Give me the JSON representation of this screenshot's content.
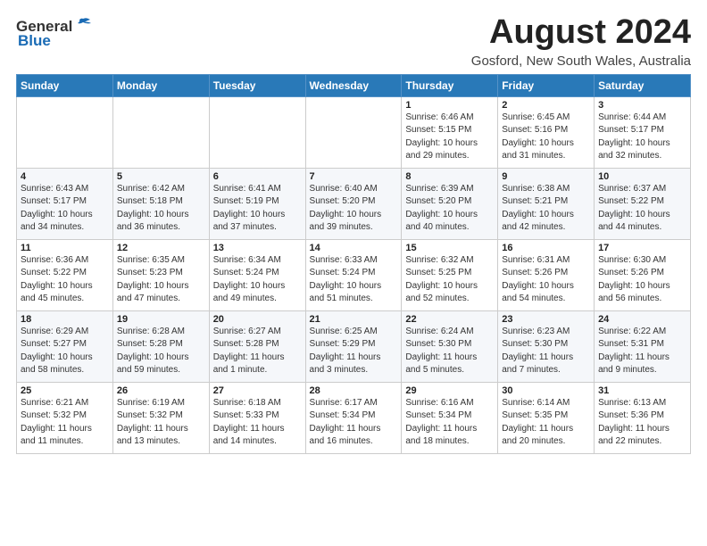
{
  "header": {
    "logo_general": "General",
    "logo_blue": "Blue",
    "month_year": "August 2024",
    "location": "Gosford, New South Wales, Australia"
  },
  "calendar": {
    "days_of_week": [
      "Sunday",
      "Monday",
      "Tuesday",
      "Wednesday",
      "Thursday",
      "Friday",
      "Saturday"
    ],
    "weeks": [
      [
        {
          "day": "",
          "sunrise": "",
          "sunset": "",
          "daylight": ""
        },
        {
          "day": "",
          "sunrise": "",
          "sunset": "",
          "daylight": ""
        },
        {
          "day": "",
          "sunrise": "",
          "sunset": "",
          "daylight": ""
        },
        {
          "day": "",
          "sunrise": "",
          "sunset": "",
          "daylight": ""
        },
        {
          "day": "1",
          "sunrise": "Sunrise: 6:46 AM",
          "sunset": "Sunset: 5:15 PM",
          "daylight": "Daylight: 10 hours and 29 minutes."
        },
        {
          "day": "2",
          "sunrise": "Sunrise: 6:45 AM",
          "sunset": "Sunset: 5:16 PM",
          "daylight": "Daylight: 10 hours and 31 minutes."
        },
        {
          "day": "3",
          "sunrise": "Sunrise: 6:44 AM",
          "sunset": "Sunset: 5:17 PM",
          "daylight": "Daylight: 10 hours and 32 minutes."
        }
      ],
      [
        {
          "day": "4",
          "sunrise": "Sunrise: 6:43 AM",
          "sunset": "Sunset: 5:17 PM",
          "daylight": "Daylight: 10 hours and 34 minutes."
        },
        {
          "day": "5",
          "sunrise": "Sunrise: 6:42 AM",
          "sunset": "Sunset: 5:18 PM",
          "daylight": "Daylight: 10 hours and 36 minutes."
        },
        {
          "day": "6",
          "sunrise": "Sunrise: 6:41 AM",
          "sunset": "Sunset: 5:19 PM",
          "daylight": "Daylight: 10 hours and 37 minutes."
        },
        {
          "day": "7",
          "sunrise": "Sunrise: 6:40 AM",
          "sunset": "Sunset: 5:20 PM",
          "daylight": "Daylight: 10 hours and 39 minutes."
        },
        {
          "day": "8",
          "sunrise": "Sunrise: 6:39 AM",
          "sunset": "Sunset: 5:20 PM",
          "daylight": "Daylight: 10 hours and 40 minutes."
        },
        {
          "day": "9",
          "sunrise": "Sunrise: 6:38 AM",
          "sunset": "Sunset: 5:21 PM",
          "daylight": "Daylight: 10 hours and 42 minutes."
        },
        {
          "day": "10",
          "sunrise": "Sunrise: 6:37 AM",
          "sunset": "Sunset: 5:22 PM",
          "daylight": "Daylight: 10 hours and 44 minutes."
        }
      ],
      [
        {
          "day": "11",
          "sunrise": "Sunrise: 6:36 AM",
          "sunset": "Sunset: 5:22 PM",
          "daylight": "Daylight: 10 hours and 45 minutes."
        },
        {
          "day": "12",
          "sunrise": "Sunrise: 6:35 AM",
          "sunset": "Sunset: 5:23 PM",
          "daylight": "Daylight: 10 hours and 47 minutes."
        },
        {
          "day": "13",
          "sunrise": "Sunrise: 6:34 AM",
          "sunset": "Sunset: 5:24 PM",
          "daylight": "Daylight: 10 hours and 49 minutes."
        },
        {
          "day": "14",
          "sunrise": "Sunrise: 6:33 AM",
          "sunset": "Sunset: 5:24 PM",
          "daylight": "Daylight: 10 hours and 51 minutes."
        },
        {
          "day": "15",
          "sunrise": "Sunrise: 6:32 AM",
          "sunset": "Sunset: 5:25 PM",
          "daylight": "Daylight: 10 hours and 52 minutes."
        },
        {
          "day": "16",
          "sunrise": "Sunrise: 6:31 AM",
          "sunset": "Sunset: 5:26 PM",
          "daylight": "Daylight: 10 hours and 54 minutes."
        },
        {
          "day": "17",
          "sunrise": "Sunrise: 6:30 AM",
          "sunset": "Sunset: 5:26 PM",
          "daylight": "Daylight: 10 hours and 56 minutes."
        }
      ],
      [
        {
          "day": "18",
          "sunrise": "Sunrise: 6:29 AM",
          "sunset": "Sunset: 5:27 PM",
          "daylight": "Daylight: 10 hours and 58 minutes."
        },
        {
          "day": "19",
          "sunrise": "Sunrise: 6:28 AM",
          "sunset": "Sunset: 5:28 PM",
          "daylight": "Daylight: 10 hours and 59 minutes."
        },
        {
          "day": "20",
          "sunrise": "Sunrise: 6:27 AM",
          "sunset": "Sunset: 5:28 PM",
          "daylight": "Daylight: 11 hours and 1 minute."
        },
        {
          "day": "21",
          "sunrise": "Sunrise: 6:25 AM",
          "sunset": "Sunset: 5:29 PM",
          "daylight": "Daylight: 11 hours and 3 minutes."
        },
        {
          "day": "22",
          "sunrise": "Sunrise: 6:24 AM",
          "sunset": "Sunset: 5:30 PM",
          "daylight": "Daylight: 11 hours and 5 minutes."
        },
        {
          "day": "23",
          "sunrise": "Sunrise: 6:23 AM",
          "sunset": "Sunset: 5:30 PM",
          "daylight": "Daylight: 11 hours and 7 minutes."
        },
        {
          "day": "24",
          "sunrise": "Sunrise: 6:22 AM",
          "sunset": "Sunset: 5:31 PM",
          "daylight": "Daylight: 11 hours and 9 minutes."
        }
      ],
      [
        {
          "day": "25",
          "sunrise": "Sunrise: 6:21 AM",
          "sunset": "Sunset: 5:32 PM",
          "daylight": "Daylight: 11 hours and 11 minutes."
        },
        {
          "day": "26",
          "sunrise": "Sunrise: 6:19 AM",
          "sunset": "Sunset: 5:32 PM",
          "daylight": "Daylight: 11 hours and 13 minutes."
        },
        {
          "day": "27",
          "sunrise": "Sunrise: 6:18 AM",
          "sunset": "Sunset: 5:33 PM",
          "daylight": "Daylight: 11 hours and 14 minutes."
        },
        {
          "day": "28",
          "sunrise": "Sunrise: 6:17 AM",
          "sunset": "Sunset: 5:34 PM",
          "daylight": "Daylight: 11 hours and 16 minutes."
        },
        {
          "day": "29",
          "sunrise": "Sunrise: 6:16 AM",
          "sunset": "Sunset: 5:34 PM",
          "daylight": "Daylight: 11 hours and 18 minutes."
        },
        {
          "day": "30",
          "sunrise": "Sunrise: 6:14 AM",
          "sunset": "Sunset: 5:35 PM",
          "daylight": "Daylight: 11 hours and 20 minutes."
        },
        {
          "day": "31",
          "sunrise": "Sunrise: 6:13 AM",
          "sunset": "Sunset: 5:36 PM",
          "daylight": "Daylight: 11 hours and 22 minutes."
        }
      ]
    ]
  }
}
